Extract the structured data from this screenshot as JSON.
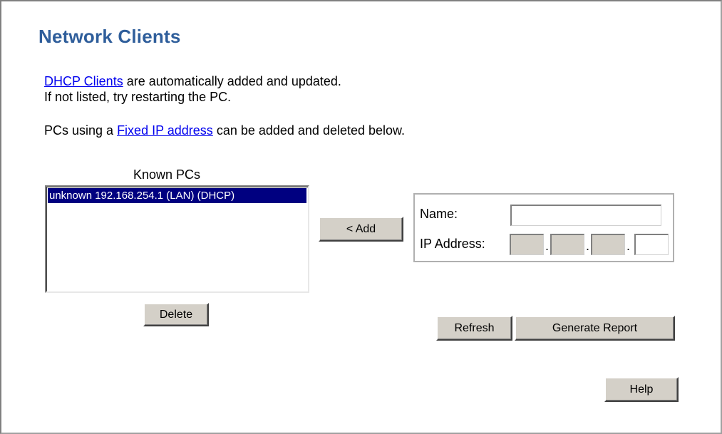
{
  "page": {
    "title": "Network Clients",
    "intro": {
      "dhcp_link": "DHCP Clients",
      "line1_rest": " are automatically added and updated.",
      "line2": "If not listed, try restarting the PC.",
      "line3_pre": "PCs using a ",
      "fixed_link": "Fixed IP address",
      "line3_post": " can be added and deleted below."
    }
  },
  "known_pcs": {
    "label": "Known PCs",
    "items": [
      "unknown 192.168.254.1 (LAN) (DHCP)"
    ],
    "selected_index": 0
  },
  "buttons": {
    "add": "< Add",
    "delete": "Delete",
    "refresh": "Refresh",
    "generate_report": "Generate Report",
    "help": "Help"
  },
  "form": {
    "name_label": "Name:",
    "name_value": "",
    "ip_label": "IP Address:",
    "ip_separator": ".",
    "ip_octets": [
      "",
      "",
      "",
      ""
    ]
  }
}
